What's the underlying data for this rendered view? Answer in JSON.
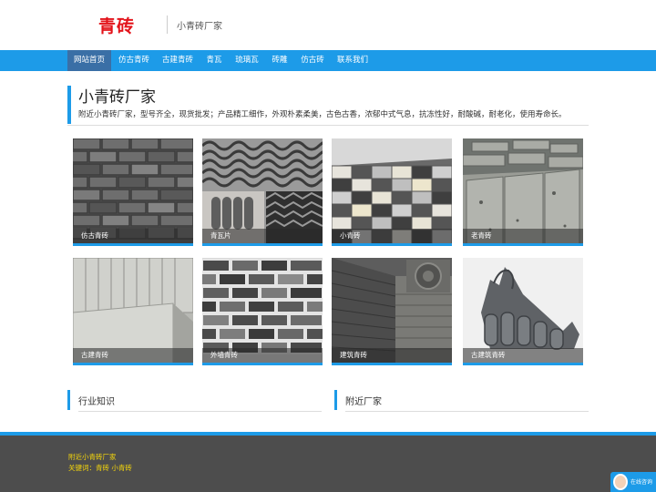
{
  "header": {
    "logo": "青砖",
    "tagline": "小青砖厂家"
  },
  "nav": {
    "items": [
      {
        "label": "网站首页",
        "active": true
      },
      {
        "label": "仿古青砖"
      },
      {
        "label": "古建青砖"
      },
      {
        "label": "青瓦"
      },
      {
        "label": "琉璃瓦"
      },
      {
        "label": "砖雕"
      },
      {
        "label": "仿古砖"
      },
      {
        "label": "联系我们"
      }
    ]
  },
  "main": {
    "title": "小青砖厂家",
    "description": "附近小青砖厂家，型号齐全，现货批发；产品精工细作，外观朴素柔美，古色古香，浓郁中式气息，抗冻性好，耐酸碱，耐老化，使用寿命长。"
  },
  "products": [
    {
      "caption": "仿古青砖",
      "image": "grey-brick-wall"
    },
    {
      "caption": "青瓦片",
      "image": "grey-roof-tiles"
    },
    {
      "caption": "小青砖",
      "image": "paving-bricks-pattern"
    },
    {
      "caption": "老青砖",
      "image": "old-stacked-bricks"
    },
    {
      "caption": "古建青砖",
      "image": "stacked-grey-bricks"
    },
    {
      "caption": "外墙青砖",
      "image": "dark-brick-wall"
    },
    {
      "caption": "建筑青砖",
      "image": "carved-brick-wall"
    },
    {
      "caption": "古建筑青砖",
      "image": "roof-ridge-tiles"
    }
  ],
  "sections": {
    "industry": "行业知识",
    "nearby": "附近厂家"
  },
  "footer": {
    "line1": "附近小青砖厂家",
    "line2": "关键词：青砖 小青砖"
  },
  "chat": {
    "label": "在线咨询",
    "icon": "customer-service-avatar-icon"
  },
  "colors": {
    "brand_red": "#e3141b",
    "accent_blue": "#1d9be8",
    "footer_bg": "#4d4d4d",
    "footer_text": "#f5d60b"
  }
}
